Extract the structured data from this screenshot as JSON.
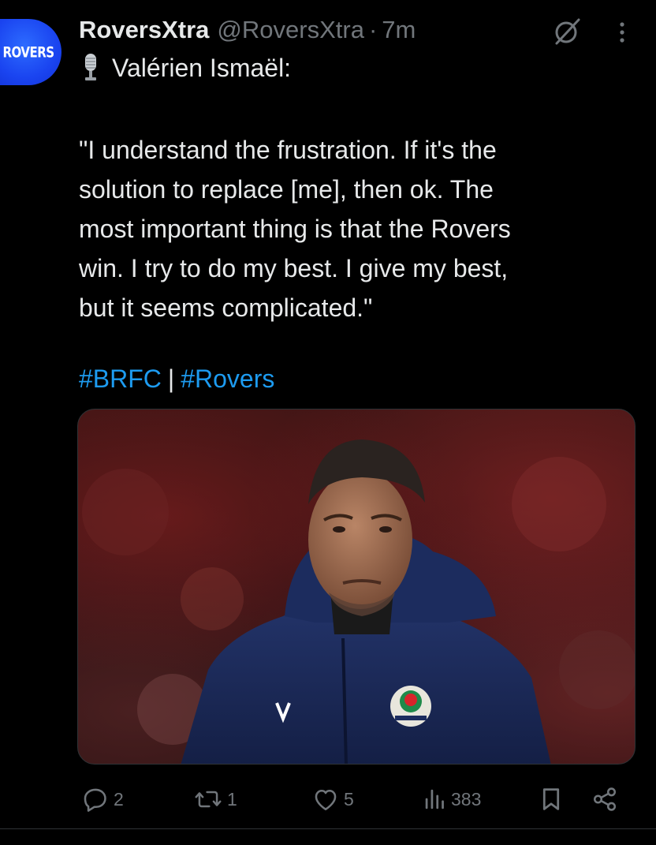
{
  "avatar": {
    "text": "ROVERS"
  },
  "header": {
    "display_name": "RoversXtra",
    "handle": "@RoversXtra",
    "dot": "·",
    "time": "7m"
  },
  "tweet": {
    "speaker": "Valérien Ismaël:",
    "quote_lines": [
      "\"I understand the frustration. If it's the",
      "solution to replace [me], then ok. The",
      "most important thing is that the Rovers",
      "win. I try to do my best. I give my best,",
      "but it seems complicated.\""
    ],
    "hashtags": [
      "#BRFC",
      "#Rovers"
    ],
    "hashtag_separator": "|"
  },
  "actions": {
    "replies": "2",
    "reposts": "1",
    "likes": "5",
    "views": "383"
  },
  "colors": {
    "background": "#000000",
    "text": "#e7e9ea",
    "secondary": "#71767b",
    "link": "#1d9bf0",
    "avatar": "#1a44f0"
  },
  "icons": {
    "speaker_prefix": "studio-microphone-icon",
    "grok": "grok-icon",
    "more": "more-vertical-icon",
    "reply": "reply-icon",
    "repost": "repost-icon",
    "like": "heart-icon",
    "views": "views-icon",
    "bookmark": "bookmark-icon",
    "share": "share-icon"
  }
}
